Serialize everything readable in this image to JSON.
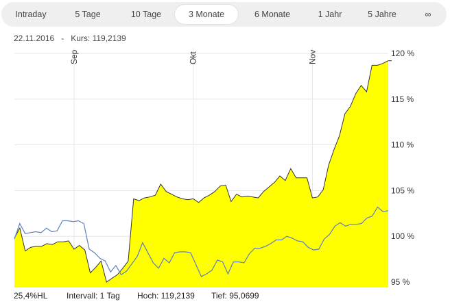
{
  "tabs": [
    {
      "label": "Intraday",
      "active": false
    },
    {
      "label": "5 Tage",
      "active": false
    },
    {
      "label": "10 Tage",
      "active": false
    },
    {
      "label": "3 Monate",
      "active": true
    },
    {
      "label": "6 Monate",
      "active": false
    },
    {
      "label": "1 Jahr",
      "active": false
    },
    {
      "label": "5 Jahre",
      "active": false
    },
    {
      "label": "∞",
      "active": false
    }
  ],
  "info": {
    "date": "22.11.2016",
    "separator": "-",
    "price_label": "Kurs:",
    "price": "119,2139"
  },
  "footer": {
    "hl": "25,4%HL",
    "interval": "Intervall: 1 Tag",
    "high": "Hoch: 119,2139",
    "low": "Tief: 95,0699"
  },
  "colors": {
    "area_fill": "#ffff00",
    "area_line": "#333333",
    "comparison_line": "#5b7fbf",
    "grid": "#e6e6e6"
  },
  "chart_data": {
    "type": "area",
    "ylim": [
      94.4,
      120.3
    ],
    "y_ticks": [
      95,
      100,
      105,
      110,
      115,
      120
    ],
    "y_tick_labels": [
      "95 %",
      "100 %",
      "105 %",
      "110 %",
      "115 %",
      "120 %"
    ],
    "y_axis_position": "right",
    "month_markers": [
      {
        "label": "Sep",
        "index": 11
      },
      {
        "label": "Okt",
        "index": 33
      },
      {
        "label": "Nov",
        "index": 55
      }
    ],
    "grid": true,
    "series": [
      {
        "type": "area",
        "values": [
          99.8,
          100.9,
          98.4,
          98.8,
          98.9,
          98.9,
          99.2,
          99.1,
          99.4,
          99.4,
          99.5,
          98.6,
          99.0,
          98.5,
          96.0,
          96.6,
          97.3,
          95.0,
          95.4,
          95.8,
          96.5,
          97.3,
          104.1,
          103.9,
          104.2,
          104.3,
          104.5,
          105.7,
          104.9,
          104.6,
          104.3,
          104.1,
          104.0,
          104.1,
          103.7,
          104.2,
          104.5,
          104.9,
          105.5,
          105.6,
          103.8,
          104.6,
          104.3,
          104.4,
          104.3,
          104.2,
          104.9,
          105.4,
          105.9,
          106.6,
          106.1,
          107.4,
          106.4,
          106.4,
          106.4,
          104.2,
          104.3,
          105.1,
          107.8,
          109.5,
          111.0,
          113.4,
          114.2,
          115.6,
          116.5,
          115.8,
          118.7,
          118.7,
          118.9,
          119.2
        ]
      },
      {
        "type": "line",
        "values": [
          99.7,
          101.4,
          100.3,
          100.4,
          100.5,
          100.4,
          100.9,
          100.5,
          100.6,
          101.7,
          101.7,
          101.6,
          101.7,
          101.4,
          98.6,
          98.2,
          97.6,
          97.3,
          96.1,
          96.8,
          95.8,
          96.2,
          97.0,
          97.8,
          99.3,
          98.2,
          97.1,
          96.5,
          97.6,
          97.1,
          98.2,
          98.3,
          98.3,
          98.2,
          96.9,
          95.6,
          95.9,
          96.3,
          97.4,
          97.2,
          95.9,
          97.2,
          97.2,
          97.1,
          98.1,
          98.7,
          98.7,
          98.9,
          99.2,
          99.6,
          99.6,
          100.0,
          99.8,
          99.5,
          99.4,
          98.8,
          98.5,
          98.6,
          99.7,
          100.2,
          101.1,
          101.5,
          101.1,
          101.3,
          101.3,
          101.4,
          102.0,
          102.2,
          103.2,
          102.7,
          102.8
        ]
      }
    ]
  }
}
